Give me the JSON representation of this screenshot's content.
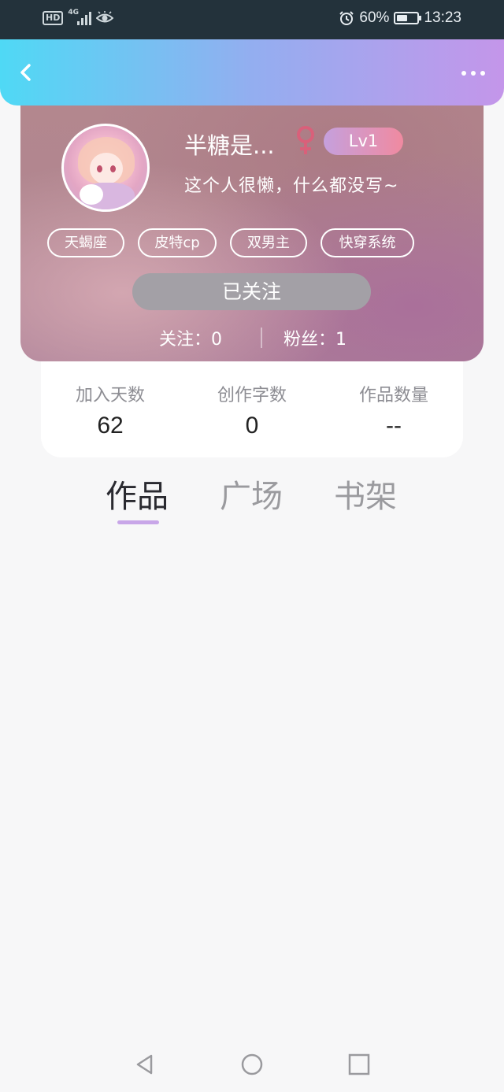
{
  "status_bar": {
    "hd": "HD",
    "network": "4G",
    "battery": "60%",
    "battery_level": 0.6,
    "time": "13:23",
    "icons": [
      "hd-icon",
      "signal-icon",
      "eye-icon",
      "alarm-icon",
      "battery-icon"
    ]
  },
  "header": {
    "back_icon": "chevron-left-icon",
    "more_icon": "more-dots-icon"
  },
  "profile": {
    "username": "半糖是...",
    "gender_icon": "female-icon",
    "level": "Lv1",
    "bio": "这个人很懒，什么都没写~",
    "tags": [
      "天蝎座",
      "皮特cp",
      "双男主",
      "快穿系统"
    ],
    "follow_button": "已关注",
    "following_text": "关注：0",
    "fans_text": "粉丝：1"
  },
  "stats": [
    {
      "label": "加入天数",
      "value": "62"
    },
    {
      "label": "创作字数",
      "value": "0"
    },
    {
      "label": "作品数量",
      "value": "--"
    }
  ],
  "tabs": [
    {
      "label": "作品",
      "active": true
    },
    {
      "label": "广场",
      "active": false
    },
    {
      "label": "书架",
      "active": false
    }
  ],
  "colors": {
    "header_gradient_start": "#4fd9f5",
    "header_gradient_end": "#c496ea",
    "tab_indicator": "#c8a6e8",
    "follow_button_bg": "#a3a0a6",
    "female_icon": "#d9607a"
  },
  "nav_bar": {
    "icons": [
      "nav-back-icon",
      "nav-home-icon",
      "nav-recent-icon"
    ]
  }
}
